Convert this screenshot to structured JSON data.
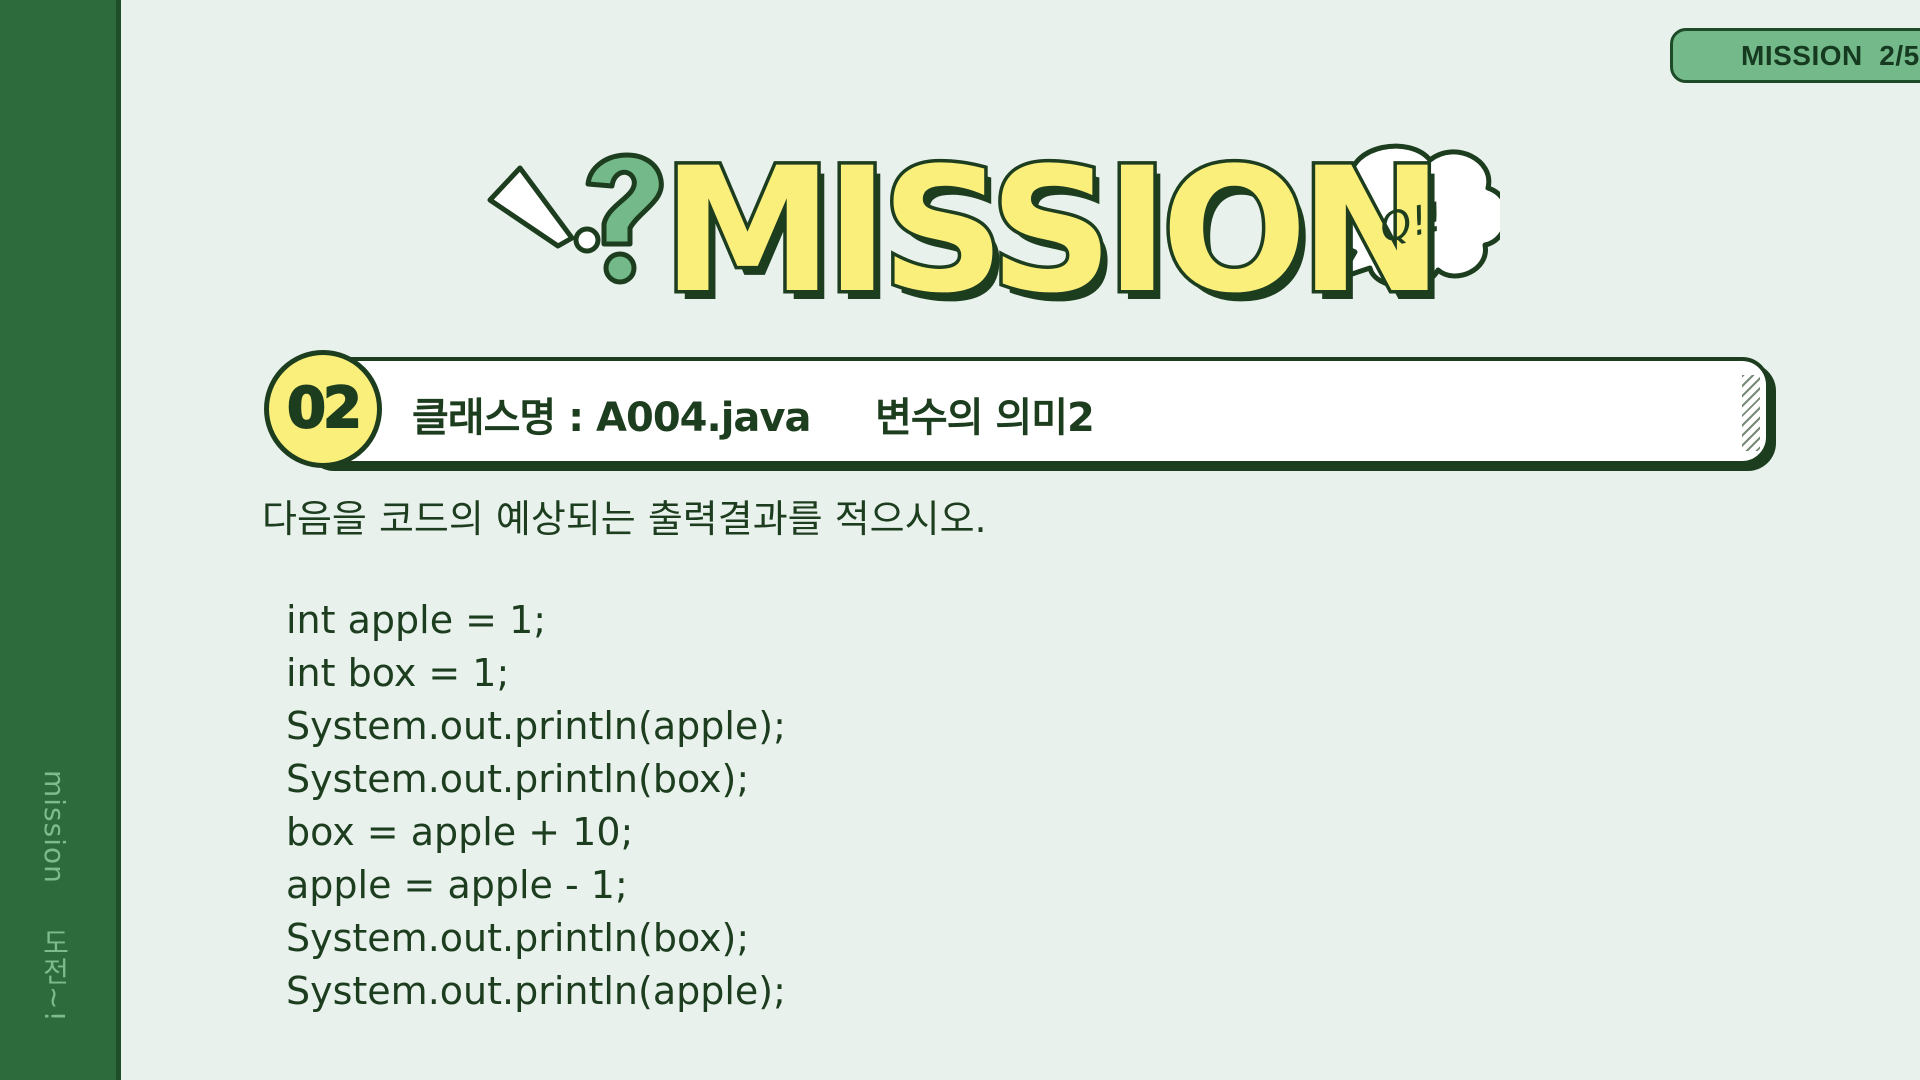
{
  "sidebar": {
    "label_en": "mission",
    "label_ko": "도전~!"
  },
  "page_counter": {
    "label": "MISSION",
    "value": "2/5"
  },
  "hero": {
    "title": "MISSION",
    "bubble": "Q!!"
  },
  "mission": {
    "number": "02",
    "title": "클래스명 : A004.java     변수의 의미2"
  },
  "instruction": "다음을 코드의 예상되는 출력결과를 적으시오.",
  "code_lines": [
    "int apple = 1;",
    "int box = 1;",
    "System.out.println(apple);",
    "System.out.println(box);",
    "box = apple + 10;",
    "apple = apple - 1;",
    "System.out.println(box);",
    "System.out.println(apple);"
  ],
  "colors": {
    "sidebar": "#2e6b3c",
    "background": "#e8f1ec",
    "accent_yellow": "#fbef7c",
    "accent_green": "#74b98a",
    "outline": "#1d3d1f"
  },
  "icons": [
    "exclamation-icon",
    "question-icon",
    "speech-bubble-icon"
  ]
}
